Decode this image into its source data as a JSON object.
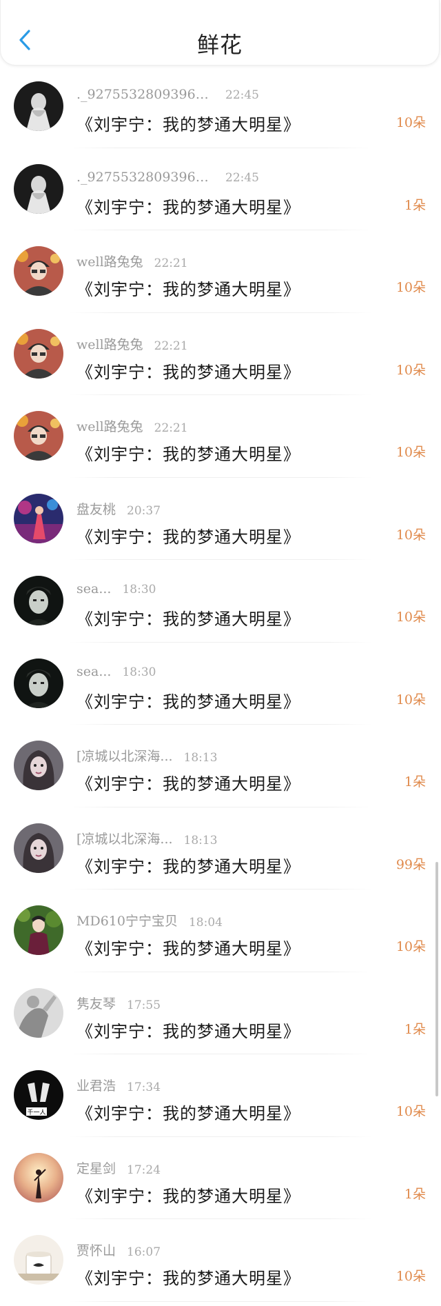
{
  "header": {
    "title": "鲜花",
    "back_icon": "chevron-left-icon",
    "accent_color": "#2a9be6"
  },
  "colors": {
    "count": "#e08a4c",
    "meta": "#9a9a9a"
  },
  "items": [
    {
      "name": "._92755328093961...",
      "time": "22:45",
      "book": "《刘宇宁：我的梦通大明星》",
      "count": "10朵",
      "avatar": "avatar-dark-figure"
    },
    {
      "name": "._92755328093961...",
      "time": "22:45",
      "book": "《刘宇宁：我的梦通大明星》",
      "count": "1朵",
      "avatar": "avatar-dark-figure"
    },
    {
      "name": "well路兔兔",
      "time": "22:21",
      "book": "《刘宇宁：我的梦通大明星》",
      "count": "10朵",
      "avatar": "avatar-cap-person"
    },
    {
      "name": "well路兔兔",
      "time": "22:21",
      "book": "《刘宇宁：我的梦通大明星》",
      "count": "10朵",
      "avatar": "avatar-cap-person"
    },
    {
      "name": "well路兔兔",
      "time": "22:21",
      "book": "《刘宇宁：我的梦通大明星》",
      "count": "10朵",
      "avatar": "avatar-cap-person"
    },
    {
      "name": "盘友桃",
      "time": "20:37",
      "book": "《刘宇宁：我的梦通大明星》",
      "count": "10朵",
      "avatar": "avatar-stage"
    },
    {
      "name": "sea...",
      "time": "18:30",
      "book": "《刘宇宁：我的梦通大明星》",
      "count": "10朵",
      "avatar": "avatar-dark-face"
    },
    {
      "name": "sea...",
      "time": "18:30",
      "book": "《刘宇宁：我的梦通大明星》",
      "count": "10朵",
      "avatar": "avatar-dark-face"
    },
    {
      "name": "[凉城以北深海...",
      "time": "18:13",
      "book": "《刘宇宁：我的梦通大明星》",
      "count": "1朵",
      "avatar": "avatar-girl"
    },
    {
      "name": "[凉城以北深海...",
      "time": "18:13",
      "book": "《刘宇宁：我的梦通大明星》",
      "count": "99朵",
      "avatar": "avatar-girl"
    },
    {
      "name": "MD610宁宁宝贝",
      "time": "18:04",
      "book": "《刘宇宁：我的梦通大明星》",
      "count": "10朵",
      "avatar": "avatar-green-suit"
    },
    {
      "name": "隽友琴",
      "time": "17:55",
      "book": "《刘宇宁：我的梦通大明星》",
      "count": "1朵",
      "avatar": "avatar-gray-hand"
    },
    {
      "name": "业君浩",
      "time": "17:34",
      "book": "《刘宇宁：我的梦通大明星》",
      "count": "10朵",
      "avatar": "avatar-bw-hands"
    },
    {
      "name": "定星剑",
      "time": "17:24",
      "book": "《刘宇宁：我的梦通大明星》",
      "count": "1朵",
      "avatar": "avatar-sunset"
    },
    {
      "name": "贾怀山",
      "time": "16:07",
      "book": "《刘宇宁：我的梦通大明星》",
      "count": "10朵",
      "avatar": "avatar-cup"
    }
  ]
}
